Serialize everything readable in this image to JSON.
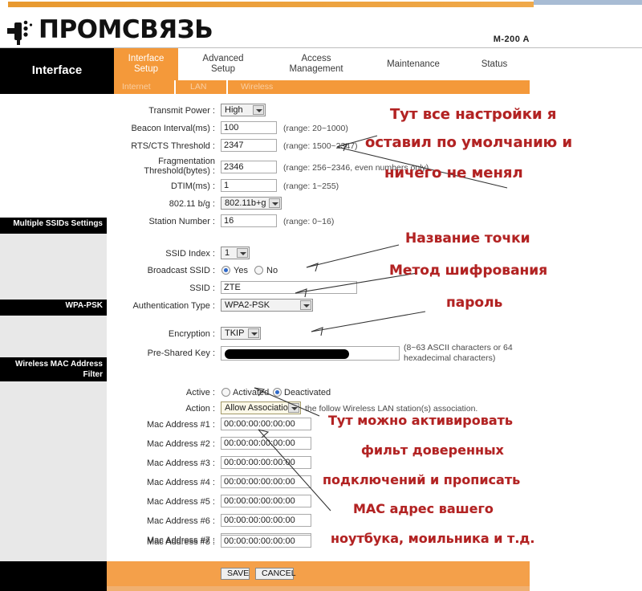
{
  "brand": {
    "logo_text": "ПРОМСВЯЗЬ",
    "model": "M-200 A"
  },
  "nav": {
    "black_label": "Interface",
    "tabs": [
      {
        "label_line1": "Interface",
        "label_line2": "Setup",
        "active": true
      },
      {
        "label_line1": "Advanced",
        "label_line2": "Setup",
        "active": false
      },
      {
        "label_line1": "Access",
        "label_line2": "Management",
        "active": false
      },
      {
        "label_line1": "Maintenance",
        "label_line2": "",
        "active": false
      },
      {
        "label_line1": "Status",
        "label_line2": "",
        "active": false
      }
    ],
    "subtabs": [
      "Internet",
      "LAN",
      "Wireless"
    ]
  },
  "sections": {
    "multiple_ssids": "Multiple SSIDs Settings",
    "wpa_psk": "WPA-PSK",
    "wireless_mac_filter_l1": "Wireless MAC Address",
    "wireless_mac_filter_l2": "Filter"
  },
  "access_point": {
    "transmit_power": {
      "label": "Transmit Power :",
      "value": "High"
    },
    "beacon_interval": {
      "label": "Beacon Interval(ms) :",
      "value": "100",
      "hint": "(range: 20~1000)"
    },
    "rts_cts": {
      "label": "RTS/CTS Threshold :",
      "value": "2347",
      "hint": "(range: 1500~2347)"
    },
    "fragmentation": {
      "label_line1": "Fragmentation",
      "label_line2": "Threshold(bytes) :",
      "value": "2346",
      "hint": "(range: 256~2346, even numbers only)"
    },
    "dtim": {
      "label": "DTIM(ms) :",
      "value": "1",
      "hint": "(range: 1~255)"
    },
    "mode": {
      "label": "802.11 b/g :",
      "value": "802.11b+g"
    },
    "station_number": {
      "label": "Station Number :",
      "value": "16",
      "hint": "(range: 0~16)"
    }
  },
  "ssid": {
    "ssid_index": {
      "label": "SSID Index :",
      "value": "1"
    },
    "broadcast": {
      "label": "Broadcast SSID :",
      "yes": "Yes",
      "no": "No",
      "selected": "Yes"
    },
    "ssid": {
      "label": "SSID :",
      "value": "ZTE"
    },
    "auth_type": {
      "label": "Authentication Type :",
      "value": "WPA2-PSK"
    }
  },
  "wpa": {
    "encryption": {
      "label": "Encryption :",
      "value": "TKIP"
    },
    "pre_shared_key": {
      "label": "Pre-Shared Key :",
      "value": "",
      "hint": "(8~63 ASCII characters or 64 hexadecimal characters)"
    }
  },
  "mac_filter": {
    "active": {
      "label": "Active :",
      "activated": "Activated",
      "deactivated": "Deactivated",
      "selected": "Deactivated"
    },
    "action": {
      "label": "Action :",
      "value": "Allow Association",
      "suffix": "the follow Wireless LAN station(s) association."
    },
    "rows": [
      {
        "label": "Mac Address #1 :",
        "value": "00:00:00:00:00:00"
      },
      {
        "label": "Mac Address #2 :",
        "value": "00:00:00:00:00:00"
      },
      {
        "label": "Mac Address #3 :",
        "value": "00:00:00:00:00:00"
      },
      {
        "label": "Mac Address #4 :",
        "value": "00:00:00:00:00:00"
      },
      {
        "label": "Mac Address #5 :",
        "value": "00:00:00:00:00:00"
      },
      {
        "label": "Mac Address #6 :",
        "value": "00:00:00:00:00:00"
      },
      {
        "label": "Mac Address #7 :",
        "value": "00:00:00:00:00:00"
      },
      {
        "label": "Mac Address #8 :",
        "value": "00:00:00:00:00:00"
      }
    ]
  },
  "footer": {
    "save": "SAVE",
    "cancel": "CANCEL"
  },
  "annotations": {
    "color": "#b22222",
    "top": [
      "Тут все настройки я",
      "оставил по умолчанию и",
      "ничего не менял"
    ],
    "ssid_name": "Название точки",
    "encryption_method": "Метод шифрования",
    "password": "пароль",
    "mac": [
      "Тут можно активировать",
      "фильт доверенных",
      "подключений и прописать",
      "MAC адрес вашего",
      "ноутбука, моильника и т.д."
    ]
  }
}
